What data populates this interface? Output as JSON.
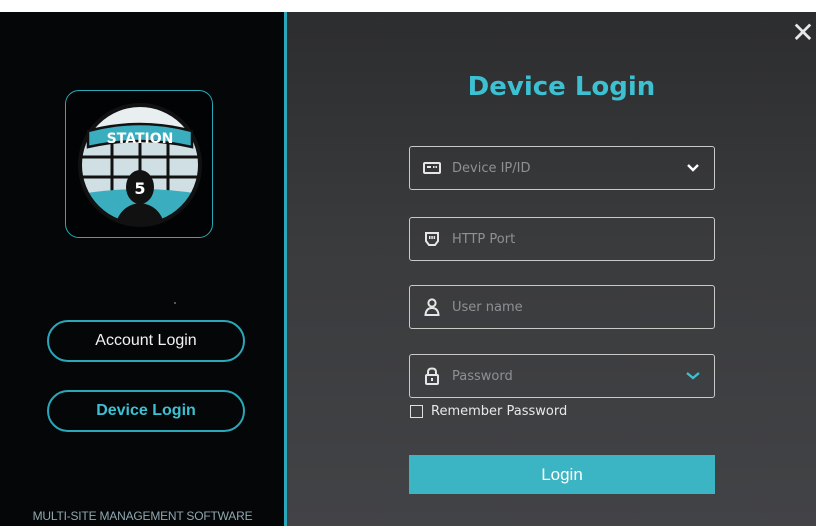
{
  "window": {
    "close_icon": "close-icon"
  },
  "logo": {
    "text": "STATION",
    "badge": "5"
  },
  "sidebar": {
    "account_login": "Account Login",
    "device_login": "Device Login",
    "footer": "MULTI-SITE MANAGEMENT SOFTWARE"
  },
  "form": {
    "title": "Device Login",
    "fields": [
      {
        "placeholder": "Device IP/ID",
        "icon": "device-icon",
        "has_dropdown": true
      },
      {
        "placeholder": "HTTP Port",
        "icon": "port-icon"
      },
      {
        "placeholder": "User name",
        "icon": "user-icon"
      },
      {
        "placeholder": "Password",
        "icon": "lock-icon",
        "has_dropdown": true
      }
    ],
    "remember_label": "Remember Password",
    "remember_checked": false,
    "login_label": "Login"
  },
  "colors": {
    "accent": "#3cc0d2",
    "button": "#3bb4c4",
    "sidebar_bg": "#050608",
    "panel_bg": "#3a3b3d"
  }
}
